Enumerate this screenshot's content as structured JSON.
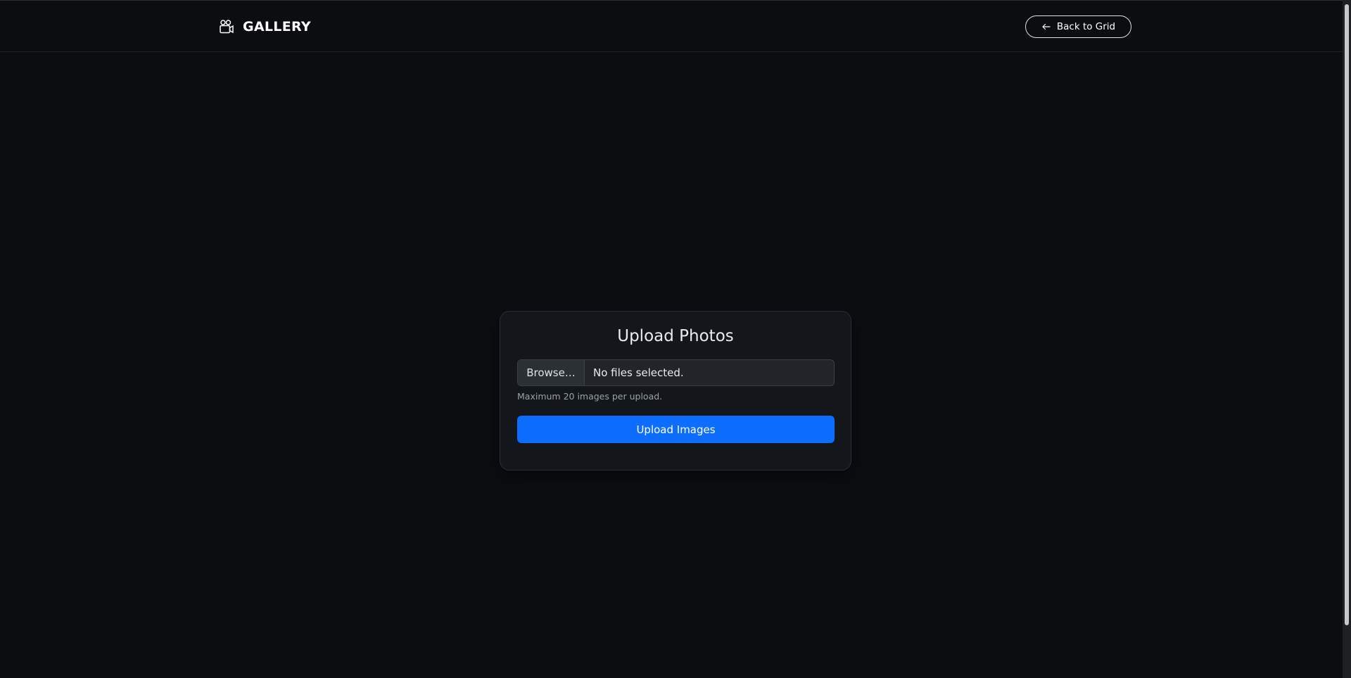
{
  "navbar": {
    "brand_icon": "camera-reels-icon",
    "brand_label": "GALLERY",
    "back_icon": "arrow-left-icon",
    "back_label": "Back to Grid"
  },
  "upload": {
    "title": "Upload Photos",
    "browse_label": "Browse…",
    "file_status": "No files selected.",
    "help_text": "Maximum 20 images per upload.",
    "submit_label": "Upload Images"
  },
  "colors": {
    "background": "#0b0d11",
    "card": "#13171c",
    "primary": "#0d6efd"
  }
}
